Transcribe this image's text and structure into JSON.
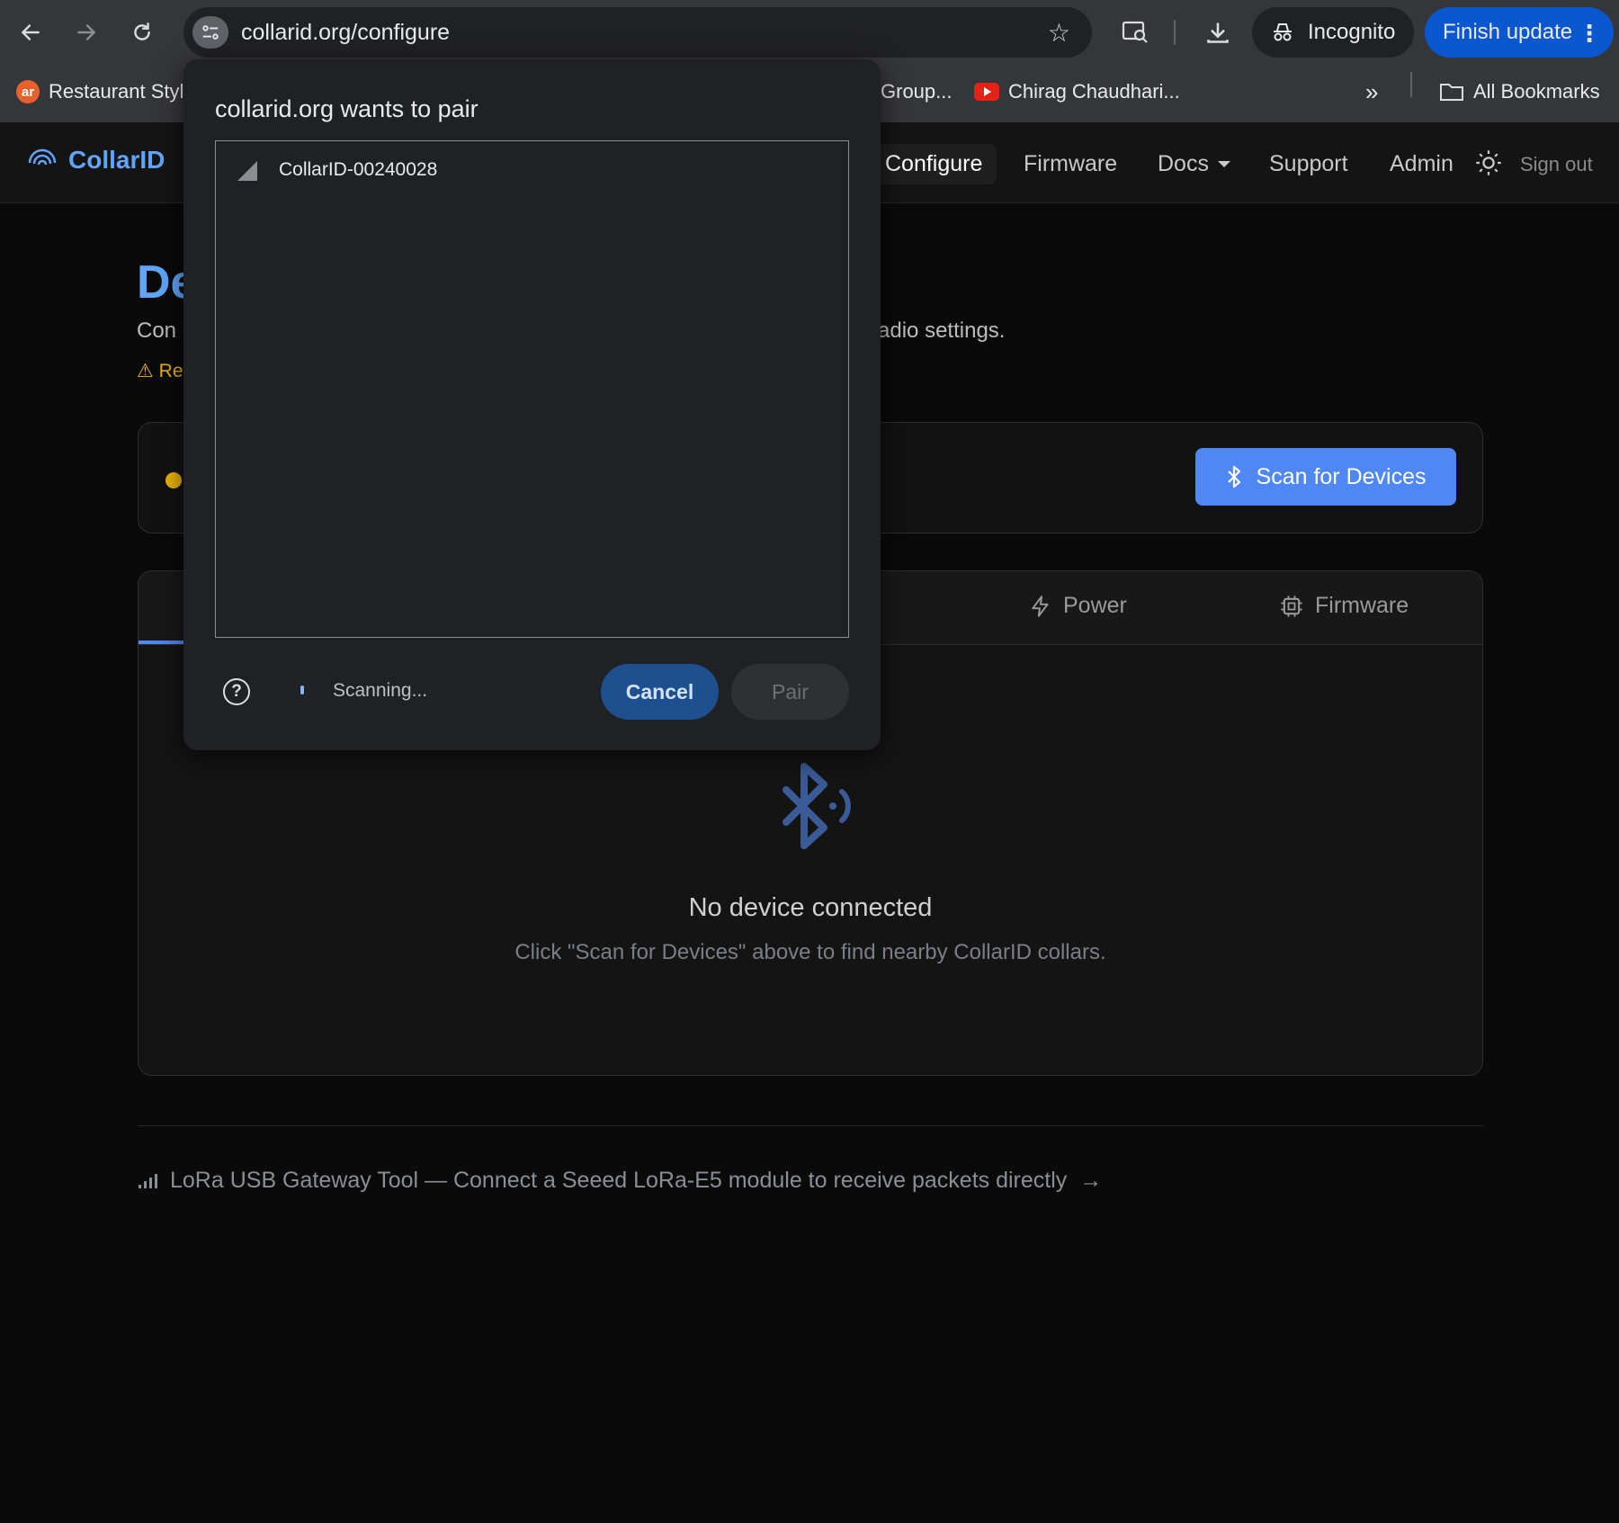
{
  "browser": {
    "url": "collarid.org/configure",
    "incognito_label": "Incognito",
    "finish_update_label": "Finish update",
    "bookmarks": [
      {
        "label": "Restaurant Styl"
      },
      {
        "label": "Group..."
      },
      {
        "label": "Chirag Chaudhari..."
      }
    ],
    "all_bookmarks_label": "All Bookmarks"
  },
  "site_nav": {
    "brand": "CollarID",
    "links": [
      "Configure",
      "Firmware",
      "Docs",
      "Support",
      "Admin"
    ],
    "sign_out": "Sign out"
  },
  "hero": {
    "title": "De",
    "subtitle_start": "Con",
    "subtitle_end": "adio settings.",
    "warning": "Re"
  },
  "status_card": {
    "scan_button": "Scan for Devices"
  },
  "tabs": [
    {
      "label": "Power"
    },
    {
      "label": "Firmware"
    }
  ],
  "empty_state": {
    "title": "No device connected",
    "subtitle": "Click \"Scan for Devices\" above to find nearby CollarID collars."
  },
  "footer_link": {
    "label": "LoRa USB Gateway Tool — Connect a Seeed LoRa-E5 module to receive packets directly"
  },
  "pair_dialog": {
    "title": "collarid.org wants to pair",
    "devices": [
      "CollarID-00240028"
    ],
    "status": "Scanning...",
    "cancel_label": "Cancel",
    "pair_label": "Pair"
  },
  "colors": {
    "accent": "#4f87f5",
    "brand": "#60a5fa",
    "warning": "#eab308"
  }
}
